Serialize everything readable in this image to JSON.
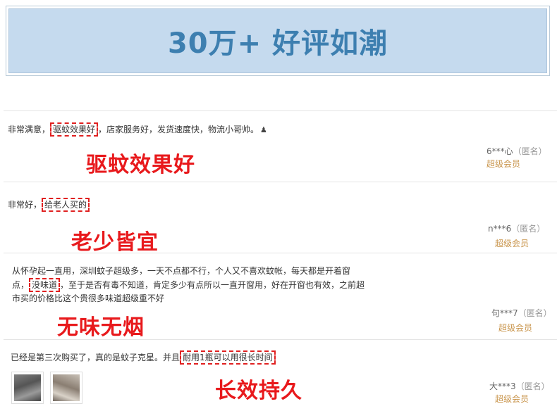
{
  "banner": {
    "title": "30万+ 好评如潮"
  },
  "reviews": [
    {
      "text_before": "非常满意，",
      "highlight": "驱蚊效果好",
      "text_after": "，店家服务好，发货速度快，物流小哥帅。",
      "tag": "驱蚊效果好",
      "user": "6***心",
      "anon": "（匿名）",
      "level": "超级会员"
    },
    {
      "text_before": "非常好，",
      "highlight": "给老人买的",
      "text_after": "",
      "tag": "老少皆宜",
      "user": "n***6",
      "anon": "（匿名）",
      "level": "超级会员"
    },
    {
      "text_line1": "从怀孕起一直用，深圳蚊子超级多，一天不点都不行，个人又不喜欢蚊帐，每天都是开着窗",
      "text_before": "点，",
      "highlight": "没味道",
      "text_after": "，至于是否有毒不知道，肯定多少有点所以一直开窗用，好在开窗也有效，之前超",
      "text_line3": "市买的价格比这个贵很多味道超级重不好",
      "tag": "无味无烟",
      "user": "句***7",
      "anon": "（匿名）",
      "level": "超级会员"
    },
    {
      "text_before": "已经是第三次购买了，真的是蚊子克星。并且",
      "highlight": "耐用1瓶可以用很长时间",
      "text_after": "",
      "tag": "长效持久",
      "user": "大***3",
      "anon": "（匿名）",
      "level": "超级会员"
    }
  ],
  "icons": {
    "pin": "push-pin-icon"
  },
  "colors": {
    "highlight_border": "#e02020",
    "tag_red": "#e8191c",
    "member_gold": "#c9954c",
    "banner_blue": "#c5daee",
    "banner_text": "#3d7fb0"
  }
}
